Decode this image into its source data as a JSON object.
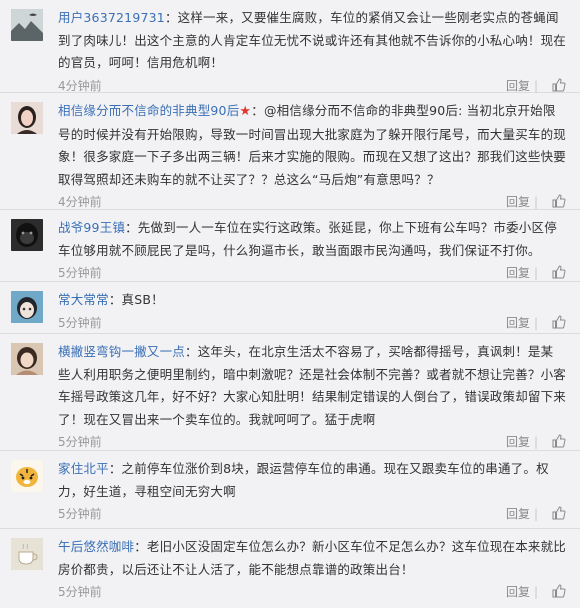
{
  "comments": [
    {
      "user": "用户3637219731",
      "text": "：这样一来，又要催生腐败，车位的紧俏又会让一些刚老实点的苍蝇闻到了肉味儿！出这个主意的人肯定车位无忧不说或许还有其他就不告诉你的小私心呐！现在的官员，呵呵！信用危机啊！",
      "time": "4分钟前",
      "reply": "回复",
      "avatar_icon": "landscape-avatar"
    },
    {
      "user": "相信缘分而不信命的非典型90后",
      "badge": "★",
      "text": "：@相信缘分而不信命的非典型90后: 当初北京开始限号的时候并没有开始限购，导致一时间冒出现大批家庭为了躲开限行尾号，而大量买车的现象！很多家庭一下子多出两三辆！后来才实施的限购。而现在又想了这出？那我们这些快要取得驾照却还未购车的就不让买了？？总这么“马后炮”有意思吗？？",
      "time": "4分钟前",
      "reply": "回复",
      "avatar_icon": "woman-avatar"
    },
    {
      "user": "战爷99王镇",
      "text": "：先做到一人一车位在实行这政策。张延昆，你上下班有公车吗？市委小区停车位够用就不顾屁民了是吗，什么狗逼市长，敢当面跟市民沟通吗，我们保证不打你。",
      "time": "5分钟前",
      "reply": "回复",
      "avatar_icon": "gorilla-avatar"
    },
    {
      "user": "常大常常",
      "text": "：真SB！",
      "time": "5分钟前",
      "reply": "回复",
      "avatar_icon": "cartoon-girl-avatar"
    },
    {
      "user": "横撇竖弯钩一撇又一点",
      "text": "：这年头，在北京生活太不容易了，买啥都得摇号，真讽刺！是某些人利用职务之便明里制约，暗中刺激呢？还是社会体制不完善？或者就不想让完善？小客车摇号政策这几年，好不好？大家心知肚明！结果制定错误的人倒台了，错误政策却留下来了！现在又冒出来一个卖车位的。我就呵呵了。猛于虎啊",
      "time": "5分钟前",
      "reply": "回复",
      "avatar_icon": "girl-avatar"
    },
    {
      "user": "家住北平",
      "text": "：之前停车位涨价到8块，跟运营停车位的串通。现在又跟卖车位的串通了。权力，好生道，寻租空间无穷大啊",
      "time": "5分钟前",
      "reply": "回复",
      "avatar_icon": "tiger-avatar"
    },
    {
      "user": "午后悠然咖啡",
      "text": "：老旧小区没固定车位怎么办？新小区车位不足怎么办？这车位现在本来就比房价都贵，以后还让不让人活了，能不能想点靠谱的政策出台！",
      "time": "5分钟前",
      "reply": "回复",
      "avatar_icon": "tea-cup-avatar"
    }
  ]
}
